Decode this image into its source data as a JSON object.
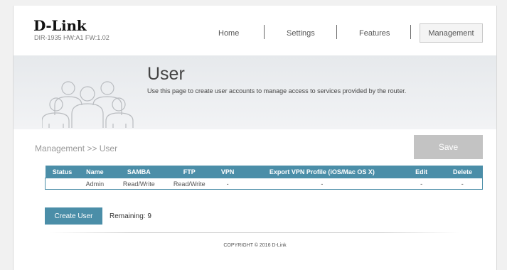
{
  "brand": {
    "name": "D-Link",
    "model_info": "DIR-1935 HW:A1 FW:1.02"
  },
  "nav": {
    "home": "Home",
    "settings": "Settings",
    "features": "Features",
    "management": "Management"
  },
  "banner": {
    "title": "User",
    "description": "Use this page to create user accounts to manage access to services provided by the router.",
    "icon": "users-group-icon"
  },
  "breadcrumb": "Management >> User",
  "toolbar": {
    "save_label": "Save"
  },
  "table": {
    "headers": [
      "Status",
      "Name",
      "SAMBA",
      "FTP",
      "VPN",
      "Export VPN Profile (iOS/Mac OS X)",
      "Edit",
      "Delete"
    ],
    "rows": [
      {
        "status": "",
        "name": "Admin",
        "samba": "Read/Write",
        "ftp": "Read/Write",
        "vpn": "-",
        "export": "-",
        "edit": "-",
        "delete": "-"
      }
    ]
  },
  "actions": {
    "create_user": "Create User",
    "remaining": "Remaining: 9"
  },
  "footer": {
    "copyright": "COPYRIGHT © 2016 D-Link"
  },
  "colors": {
    "accent": "#4b8ea8",
    "save_disabled": "#c3c3c3",
    "banner_bg": "#e9ebee"
  }
}
